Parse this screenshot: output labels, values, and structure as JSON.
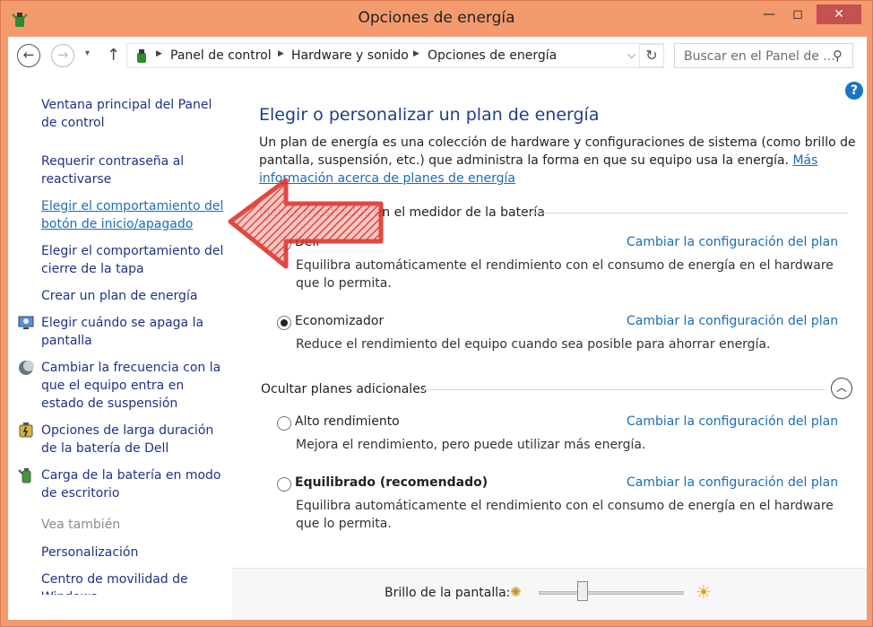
{
  "window": {
    "title": "Opciones de energía",
    "min": "—",
    "max": "◻",
    "close": "✕"
  },
  "address": {
    "crumbs": [
      "Panel de control",
      "Hardware y sonido",
      "Opciones de energía"
    ],
    "search_placeholder": "Buscar en el Panel de ..."
  },
  "sidebar": {
    "items": [
      {
        "label": "Ventana principal del Panel de control"
      },
      {
        "label": "Requerir contraseña al reactivarse"
      },
      {
        "label": "Elegir el comportamiento del botón de inicio/apagado"
      },
      {
        "label": "Elegir el comportamiento del cierre de la tapa"
      },
      {
        "label": "Crear un plan de energía"
      },
      {
        "label": "Elegir cuándo se apaga la pantalla"
      },
      {
        "label": "Cambiar la frecuencia con la que el equipo entra en estado de suspensión"
      },
      {
        "label": "Opciones de larga duración de la batería de Dell"
      },
      {
        "label": "Carga de la batería en modo de escritorio"
      }
    ],
    "see_also": "Vea también",
    "see_also_items": [
      {
        "label": "Personalización"
      },
      {
        "label": "Centro de movilidad de Windows"
      }
    ]
  },
  "main": {
    "title": "Elegir o personalizar un plan de energía",
    "description": "Un plan de energía es una colección de hardware y configuraciones de sistema (como brillo de pantalla, suspensión, etc.) que administra la forma en que su equipo usa la energía.",
    "more_info": "Más información acerca de planes de energía",
    "group_battery": "Planes mostrados en el medidor de la batería",
    "group_hidden": "Ocultar planes adicionales",
    "change_link": "Cambiar la configuración del plan",
    "plans": [
      {
        "name": "Dell",
        "desc": "Equilibra automáticamente el rendimiento con el consumo de energía en el hardware que lo permita.",
        "checked": false
      },
      {
        "name": "Economizador",
        "desc": "Reduce el rendimiento del equipo cuando sea posible para ahorrar energía.",
        "checked": true
      },
      {
        "name": "Alto rendimiento",
        "desc": "Mejora el rendimiento, pero puede utilizar más energía.",
        "checked": false
      },
      {
        "name": "Equilibrado (recomendado)",
        "desc": "Equilibra automáticamente el rendimiento con el consumo de energía en el hardware que lo permita.",
        "checked": false
      }
    ]
  },
  "bottom": {
    "brightness_label": "Brillo de la pantalla:",
    "brightness_level": 0.3
  },
  "colors": {
    "accent": "#1a6db8",
    "nav_link": "#1e3287",
    "close": "#c75050",
    "border": "#f39a6e",
    "arrow": "#e0342e"
  }
}
